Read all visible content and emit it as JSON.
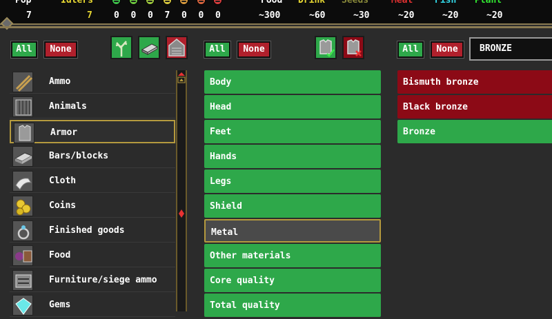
{
  "status": {
    "headers": [
      "Pop",
      "Idlers",
      "Food",
      "Drink",
      "Seeds",
      "Meat",
      "Fish",
      "Plant"
    ],
    "header_colors": [
      "#ffffff",
      "#e8d832",
      "#ffffff",
      "#e8d832",
      "#8a8a3a",
      "#e83232",
      "#32d8e8",
      "#32e832"
    ],
    "pop": "7",
    "idlers": "7",
    "mood_faces": [
      {
        "icon": "ecstatic-face-icon",
        "color": "#3ec24a",
        "count": "0"
      },
      {
        "icon": "happy-face-icon",
        "color": "#6cc83e",
        "count": "0"
      },
      {
        "icon": "content-face-icon",
        "color": "#9ec83e",
        "count": "0"
      },
      {
        "icon": "fine-face-icon",
        "color": "#d8c83e",
        "count": "7"
      },
      {
        "icon": "unhappy-face-icon",
        "color": "#d89a3e",
        "count": "0"
      },
      {
        "icon": "sad-face-icon",
        "color": "#d8643e",
        "count": "0"
      },
      {
        "icon": "miserable-face-icon",
        "color": "#d83e3e",
        "count": "0"
      }
    ],
    "stocks": [
      "~300",
      "~60",
      "~30",
      "~20",
      "~20",
      "~20"
    ]
  },
  "col1": {
    "all_label": "All",
    "none_label": "None"
  },
  "col2": {
    "all_label": "All",
    "none_label": "None"
  },
  "col3": {
    "all_label": "All",
    "none_label": "None"
  },
  "search": {
    "value": "BRONZE"
  },
  "filter_icons": [
    "tree-icon",
    "bar-icon",
    "stone-icon"
  ],
  "armor_toggle_icons": [
    "armor-enable-icon",
    "armor-disable-icon"
  ],
  "categories": [
    {
      "label": "Ammo",
      "icon": "ammo-icon",
      "selected": false
    },
    {
      "label": "Animals",
      "icon": "cage-icon",
      "selected": false
    },
    {
      "label": "Armor",
      "icon": "armor-icon",
      "selected": true
    },
    {
      "label": "Bars/blocks",
      "icon": "bar-icon",
      "selected": false
    },
    {
      "label": "Cloth",
      "icon": "cloth-icon",
      "selected": false
    },
    {
      "label": "Coins",
      "icon": "coins-icon",
      "selected": false
    },
    {
      "label": "Finished goods",
      "icon": "ring-icon",
      "selected": false
    },
    {
      "label": "Food",
      "icon": "food-icon",
      "selected": false
    },
    {
      "label": "Furniture/siege ammo",
      "icon": "furniture-icon",
      "selected": false
    },
    {
      "label": "Gems",
      "icon": "gem-icon",
      "selected": false
    }
  ],
  "subcategories": [
    {
      "label": "Body",
      "state": "enabled"
    },
    {
      "label": "Head",
      "state": "enabled"
    },
    {
      "label": "Feet",
      "state": "enabled"
    },
    {
      "label": "Hands",
      "state": "enabled"
    },
    {
      "label": "Legs",
      "state": "enabled"
    },
    {
      "label": "Shield",
      "state": "enabled"
    },
    {
      "label": "Metal",
      "state": "selected"
    },
    {
      "label": "Other materials",
      "state": "enabled"
    },
    {
      "label": "Core quality",
      "state": "enabled"
    },
    {
      "label": "Total quality",
      "state": "enabled"
    }
  ],
  "materials": [
    {
      "label": "Bismuth bronze",
      "state": "disabled"
    },
    {
      "label": "Black bronze",
      "state": "disabled"
    },
    {
      "label": "Bronze",
      "state": "enabled"
    }
  ]
}
